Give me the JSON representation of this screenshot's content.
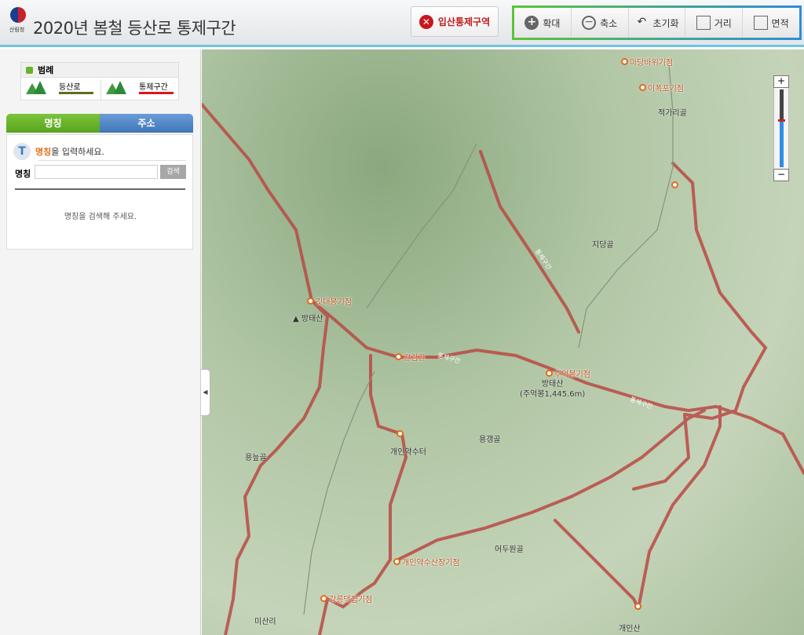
{
  "header": {
    "logo_text": "산림청",
    "title": "2020년 봄철 등산로 통제구간",
    "ban_button": "입산통제구역",
    "tools": [
      {
        "icon": "zoom-in-icon",
        "label": "확대"
      },
      {
        "icon": "zoom-out-icon",
        "label": "축소"
      },
      {
        "icon": "reset-icon",
        "label": "초기화"
      },
      {
        "icon": "distance-icon",
        "label": "거리"
      },
      {
        "icon": "area-icon",
        "label": "면적"
      }
    ]
  },
  "legend": {
    "title": "범례",
    "items": [
      {
        "label": "등산로",
        "color": "#5b6e1e"
      },
      {
        "label": "통제구간",
        "color": "#e0141c"
      }
    ]
  },
  "search": {
    "tabs": [
      "명칭",
      "주소"
    ],
    "hint_keyword": "명칭",
    "hint_rest": "을 입력하세요.",
    "field_label": "명칭",
    "value": "",
    "button": "검색",
    "empty_message": "명칭을 검색해 주세요."
  },
  "map": {
    "zoom_level_percent": 60,
    "points": [
      "마당바위기점",
      "이폭포기점",
      "깃대봉기점",
      "갈림길",
      "주억봉기점",
      "개인약수터",
      "개인약수산장기점",
      "강릉댁집기점"
    ],
    "places": [
      "적가리골",
      "지당골",
      "방태산",
      "방태산",
      "(주억봉1,445.6m)",
      "용갱골",
      "용늪골",
      "어두원골",
      "미산리",
      "개인산"
    ],
    "route_label": "통제구간"
  }
}
